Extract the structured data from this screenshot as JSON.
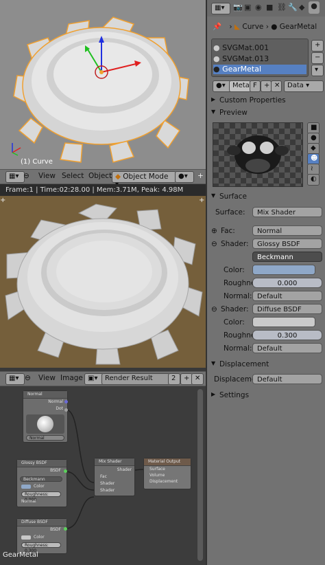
{
  "viewport": {
    "object_label": "(1) Curve"
  },
  "view3d_header": {
    "menu": [
      "View",
      "Select",
      "Object"
    ],
    "mode": "Object Mode"
  },
  "render_info": "Frame:1 | Time:02:28.00 | Mem:3.71M, Peak: 4.98M",
  "image_header": {
    "menu": [
      "View",
      "Image"
    ],
    "image_name": "Render Result",
    "slot": "2"
  },
  "nodes": {
    "normal": {
      "title": "Normal",
      "out_normal": "Normal",
      "out_dot": "Dot",
      "field": "Normal"
    },
    "glossy": {
      "title": "Glossy BSDF",
      "out": "BSDF",
      "distribution": "Beckmann",
      "color": "Color",
      "roughness": "Roughness: 0.000",
      "normal": "Normal"
    },
    "diffuse": {
      "title": "Diffuse BSDF",
      "out": "BSDF",
      "color": "Color",
      "roughness": "Roughness: 0.300",
      "normal": "Normal"
    },
    "mix": {
      "title": "Mix Shader",
      "out": "Shader",
      "fac": "Fac",
      "shader1": "Shader",
      "shader2": "Shader"
    },
    "output": {
      "title": "Material Output",
      "surface": "Surface",
      "volume": "Volume",
      "displacement": "Displacement"
    },
    "material_name": "GearMetal"
  },
  "props": {
    "breadcrumb": {
      "object": "Curve",
      "material": "GearMetal"
    },
    "slots": [
      "SVGMat.001",
      "SVGMat.013",
      "GearMetal"
    ],
    "selected_slot": 2,
    "mat_field": "Metal",
    "mat_f": "F",
    "link": "Data",
    "sections": {
      "custom_properties": "Custom Properties",
      "preview": "Preview",
      "surface": "Surface",
      "displacement": "Displacement",
      "settings": "Settings"
    },
    "surface": {
      "surface_label": "Surface:",
      "surface_value": "Mix Shader",
      "fac_label": "Fac:",
      "fac_value": "Normal",
      "shader1_label": "Shader:",
      "shader1_value": "Glossy BSDF",
      "distribution": "Beckmann",
      "color_label": "Color:",
      "rough1_label": "Roughne",
      "rough1_value": "0.000",
      "normal1_label": "Normal:",
      "normal1_value": "Default",
      "shader2_label": "Shader:",
      "shader2_value": "Diffuse BSDF",
      "color2_label": "Color:",
      "rough2_label": "Roughne",
      "rough2_value": "0.300",
      "normal2_label": "Normal:",
      "normal2_value": "Default"
    },
    "displacement": {
      "label": "Displaceme",
      "value": "Default"
    }
  },
  "colors": {
    "selected": "#5680c2",
    "viewport_bg": "#8d8d8d",
    "render_bg": "#755f3b"
  }
}
